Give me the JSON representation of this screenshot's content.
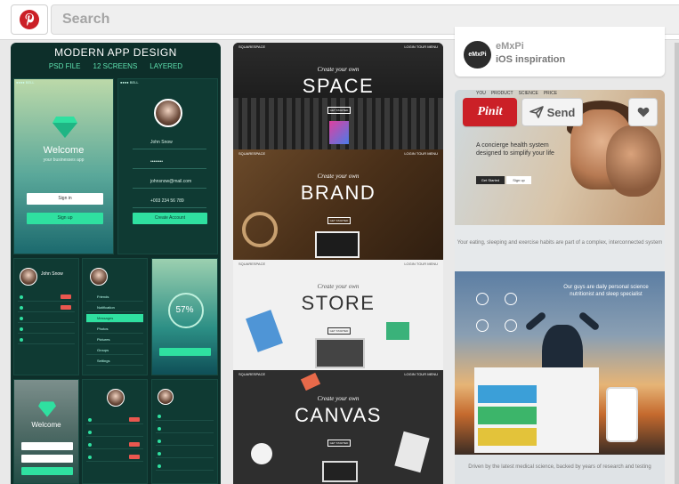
{
  "header": {
    "search_placeholder": "Search"
  },
  "colors": {
    "brand_red": "#cb2027",
    "background": "#e9e9e9"
  },
  "pin_app_design": {
    "title": "MODERN APP DESIGN",
    "tags": [
      "PSD FILE",
      "12 SCREENS",
      "LAYERED"
    ],
    "welcome": "Welcome",
    "welcome_sub": "your businesses app",
    "sign_in": "Sign in",
    "sign_up": "Sign up",
    "profile_name": "John Snow",
    "profile_email": "johnsnow@mail.com",
    "profile_phone": "+003 234 56 789",
    "create_account": "Create Account",
    "percent": "57%",
    "menu_items": [
      "Friends",
      "Notification",
      "Messages",
      "Photos",
      "Pictures",
      "Groups",
      "Settings"
    ]
  },
  "pin_squarespace": {
    "brand": "SQUARESPACE",
    "nav": [
      "LOGIN",
      "TOUR",
      "MENU"
    ],
    "create_label": "Create your own",
    "cta": "GET STARTED",
    "sections": [
      "SPACE",
      "BRAND",
      "STORE",
      "CANVAS"
    ]
  },
  "pin_emxpi": {
    "avatar_text": "eMxPi",
    "user": "eMxPi",
    "board": "iOS inspiration"
  },
  "pin_health": {
    "pinit_label": "Pinit",
    "send_label": "Send",
    "nav": [
      "YOU",
      "PRODUCT",
      "SCIENCE",
      "PRICE"
    ],
    "headline": "A concierge health system designed to simplify your life",
    "btn_dark": "Get Started",
    "btn_light": "Sign up",
    "mid_text": "Your eating, sleeping and exercise habits are part of a complex, interconnected system",
    "sunset_text": "Our guys are daily personal science nutritionist and sleep specialist",
    "bottom_text": "Driven by the latest medical science, backed by years of research and testing"
  }
}
